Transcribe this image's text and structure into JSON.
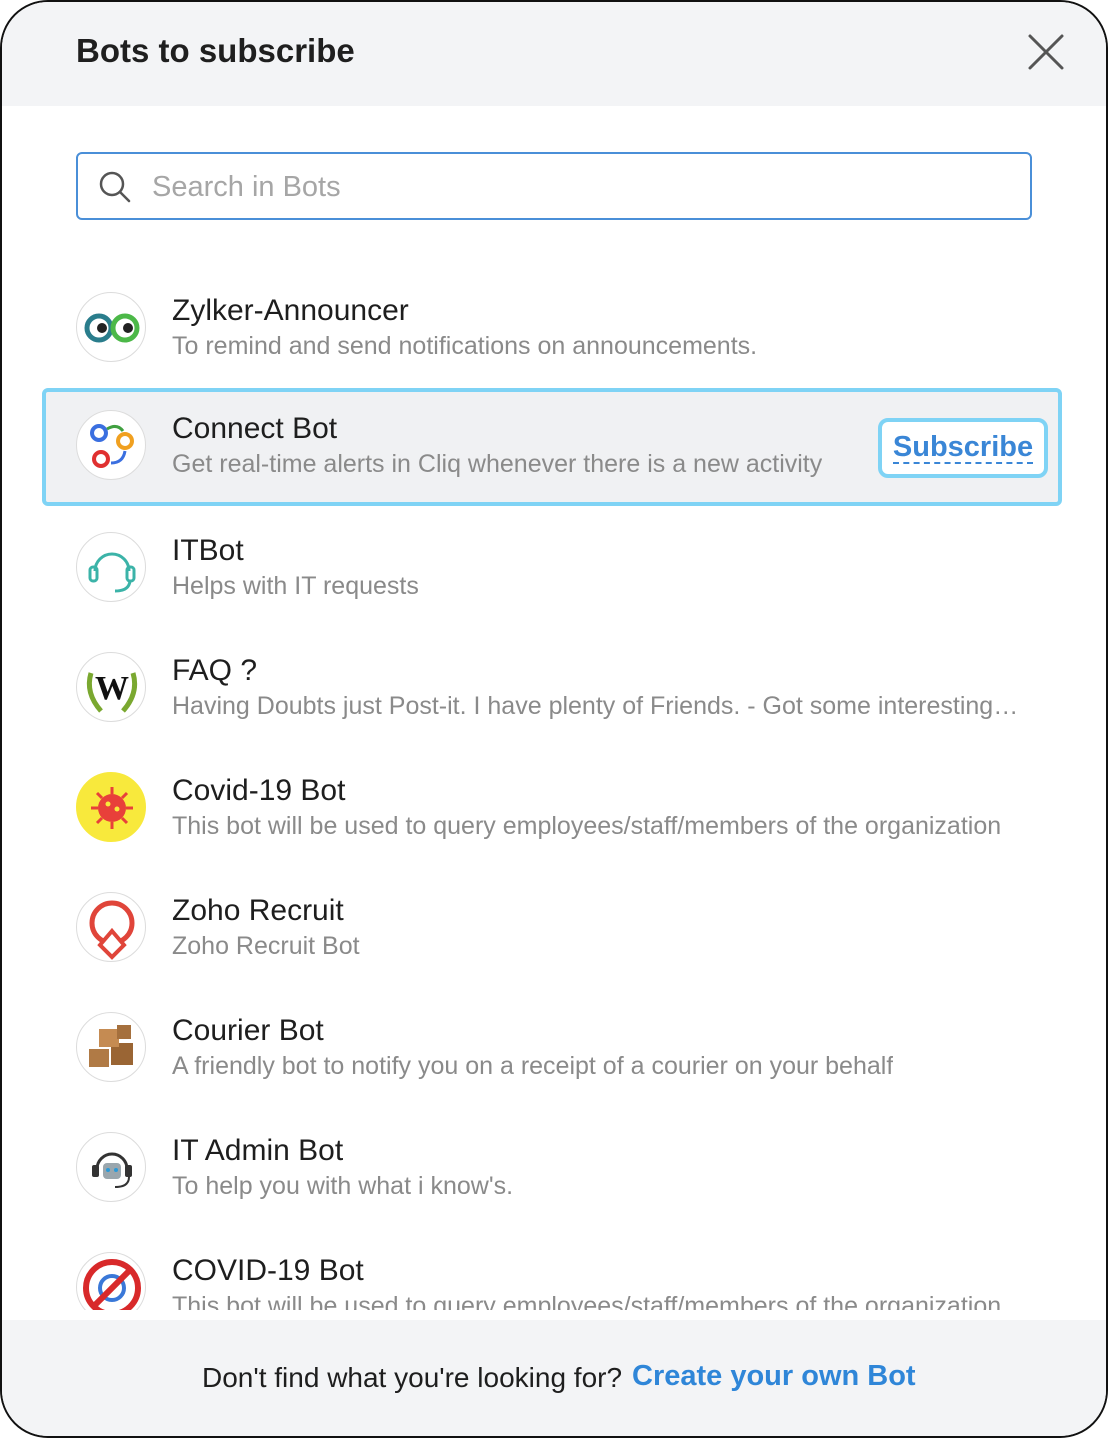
{
  "header": {
    "title": "Bots to subscribe"
  },
  "search": {
    "placeholder": "Search in Bots"
  },
  "bots": [
    {
      "name": "Zylker-Announcer",
      "description": "To remind and send notifications on announcements.",
      "icon": "eyes-icon"
    },
    {
      "name": "Connect Bot",
      "description": "Get real-time alerts in Cliq whenever there is a new activity",
      "icon": "connect-circles-icon",
      "selected": true,
      "action": "Subscribe"
    },
    {
      "name": "ITBot",
      "description": "Helps with IT requests",
      "icon": "headset-icon"
    },
    {
      "name": "FAQ ?",
      "description": "Having Doubts just Post-it. I have plenty of Friends. - Got some interesting things to share",
      "icon": "laurel-w-icon"
    },
    {
      "name": "Covid-19 Bot",
      "description": "This bot will be used to query employees/staff/members of the organization",
      "icon": "virus-icon"
    },
    {
      "name": "Zoho Recruit",
      "description": "Zoho Recruit Bot",
      "icon": "recruit-logo-icon"
    },
    {
      "name": "Courier Bot",
      "description": "A friendly bot to notify you on a receipt of a courier on your behalf",
      "icon": "boxes-icon"
    },
    {
      "name": "IT Admin Bot",
      "description": "To help you with what i know's.",
      "icon": "robot-headset-icon"
    },
    {
      "name": "COVID-19 Bot",
      "description": "This bot will be used to query employees/staff/members of the organization",
      "icon": "no-virus-icon"
    }
  ],
  "footer": {
    "question": "Don't find what you're looking for?",
    "link": "Create your own Bot"
  },
  "colors": {
    "accent": "#2f86d8",
    "selection_border": "#7fd3f5",
    "header_bg": "#f3f4f6"
  }
}
